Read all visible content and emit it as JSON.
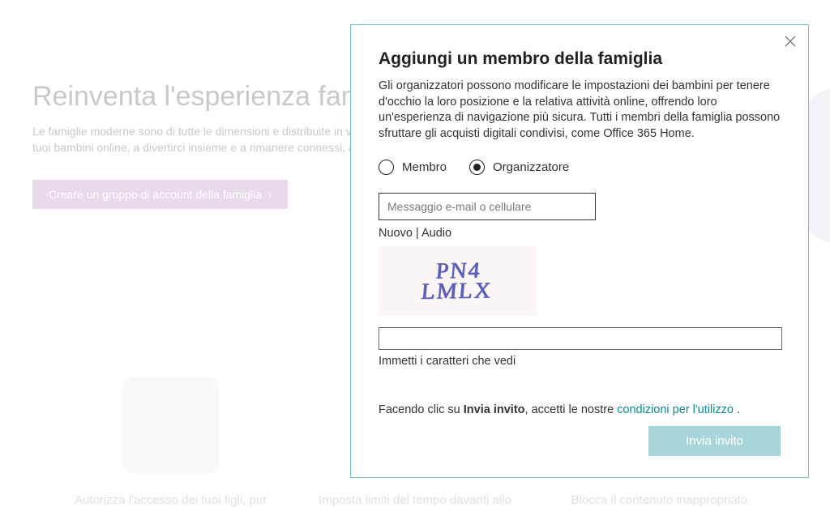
{
  "background": {
    "title": "Reinventa l'esperienza fam",
    "subtitle_line1": "Le famiglie moderne sono di tutte le dimensioni e distribuite in v",
    "subtitle_line2": "tuoi bambini online, a divertirci insieme e a rimanere connessi, a",
    "cta_label": "Creare un gruppo di account della famiglia",
    "tiles": [
      "Autorizza l'accesso dei tuoi figli, pur",
      "Imposta limiti del tempo davanti allo",
      "Blocca il contenuto inappropriato"
    ]
  },
  "modal": {
    "title": "Aggiungi un membro della famiglia",
    "description": "Gli organizzatori possono modificare le impostazioni dei bambini per tenere d'occhio la loro posizione e la relativa attività online, offrendo loro un'esperienza di navigazione più sicura. Tutti i membri della famiglia possono sfruttare gli acquisti digitali condivisi, come Office 365 Home.",
    "role": {
      "member_label": "Membro",
      "organizer_label": "Organizzatore",
      "selected": "organizer"
    },
    "email_placeholder": "Messaggio e-mail o cellulare",
    "captcha": {
      "new_label": "Nuovo",
      "sep": " | ",
      "audio_label": "Audio",
      "image_text_line1": "PN4",
      "image_text_line2": "LMLX",
      "input_value": "",
      "hint": "Immetti i caratteri che vedi"
    },
    "consent": {
      "prefix": "Facendo clic su ",
      "bold": "Invia invito",
      "middle": ", accetti le nostre ",
      "link": "condizioni per l'utilizzo",
      "suffix": " ."
    },
    "send_label": "Invia invito"
  }
}
